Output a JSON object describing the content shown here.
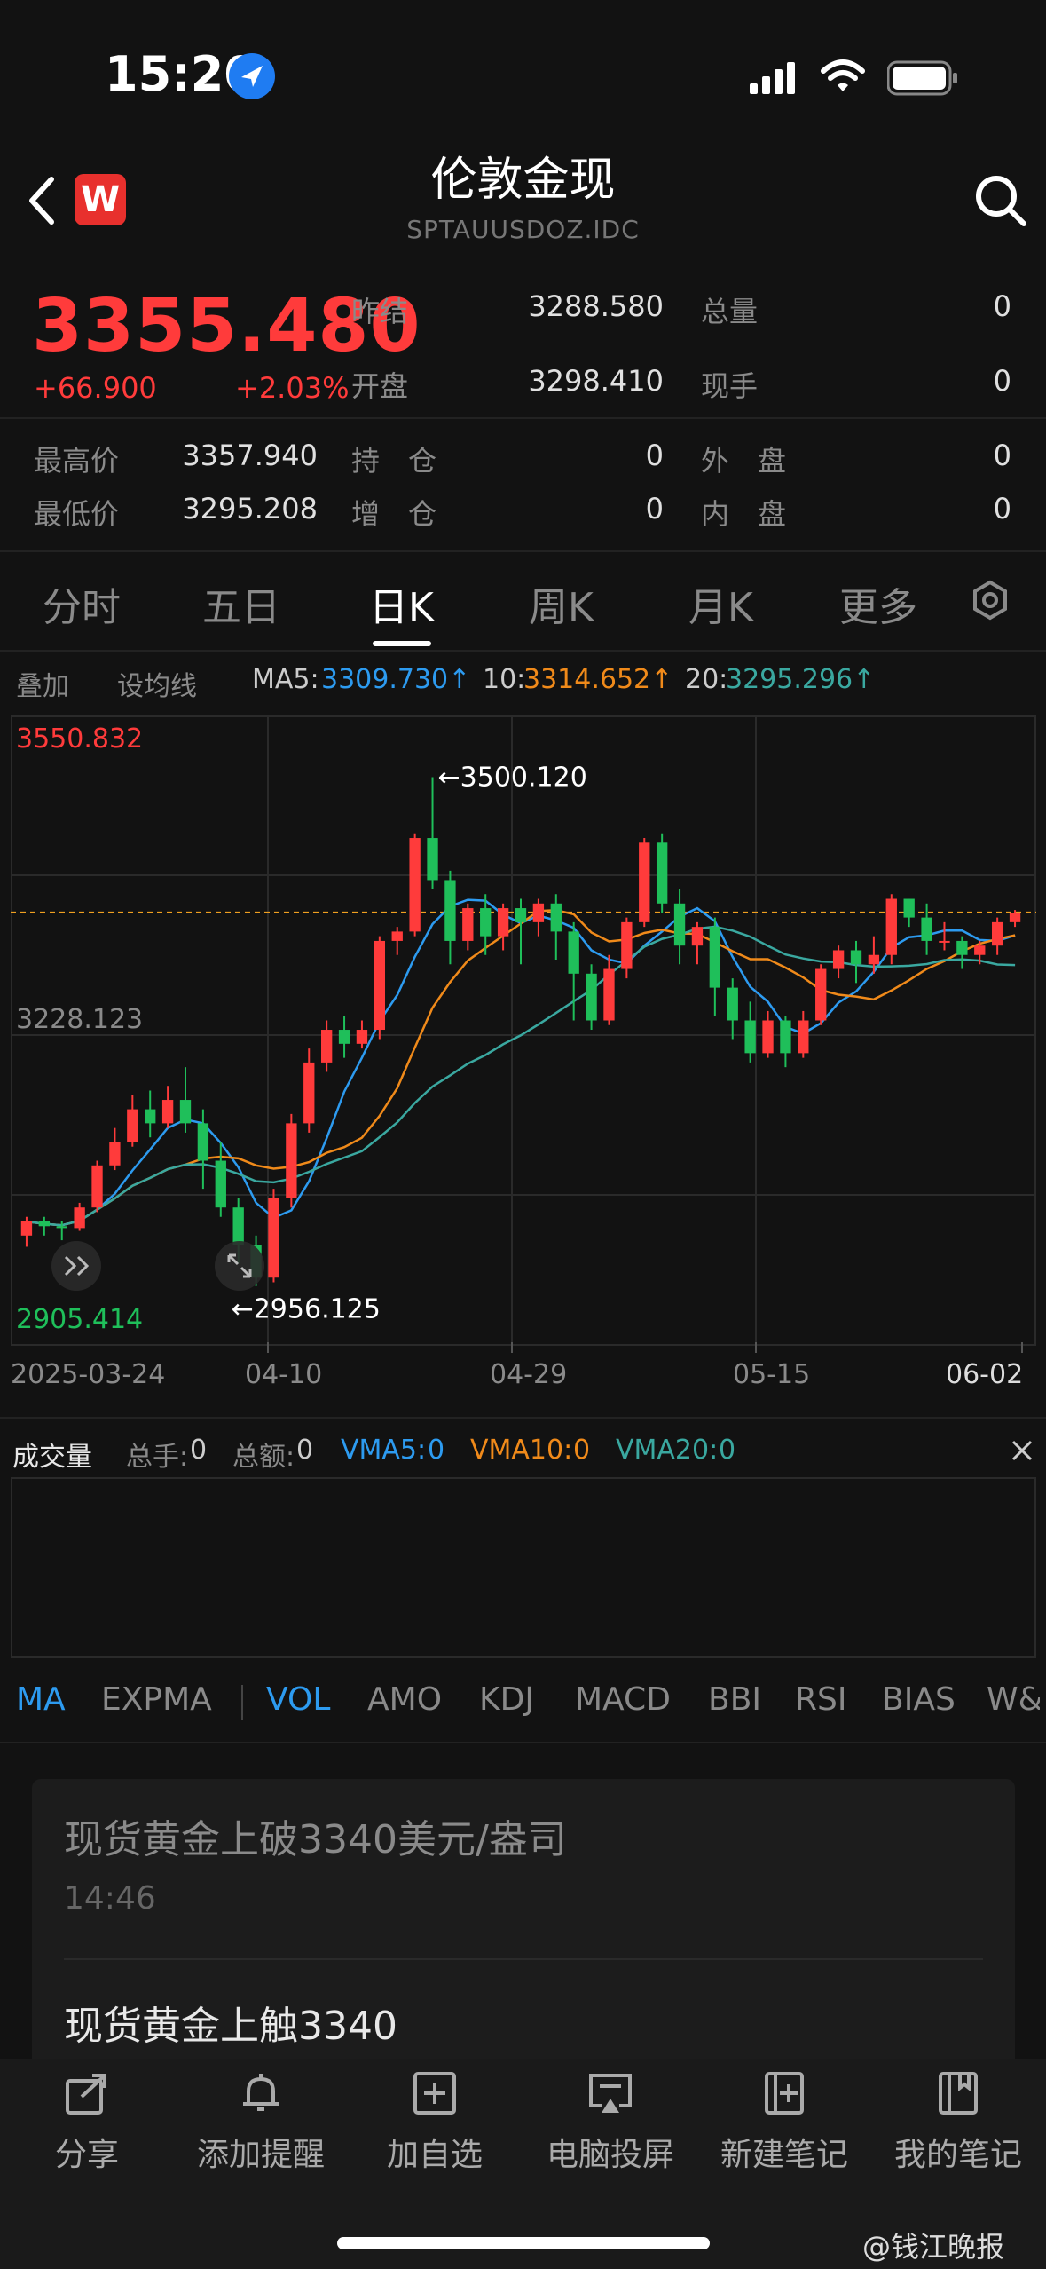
{
  "status": {
    "time": "15:20"
  },
  "header": {
    "title": "伦敦金现",
    "subtitle": "SPTAUUSDOZ.IDC",
    "logo_letter": "W"
  },
  "quote": {
    "price": "3355.480",
    "change_abs": "+66.900",
    "change_pct": "+2.03%",
    "fields": [
      {
        "label": "昨结",
        "value": "3288.580"
      },
      {
        "label": "开盘",
        "value": "3298.410"
      },
      {
        "label": "总量",
        "value": "0"
      },
      {
        "label": "现手",
        "value": "0"
      },
      {
        "label": "最高价",
        "value": "3357.940"
      },
      {
        "label": "最低价",
        "value": "3295.208"
      },
      {
        "label": "持　仓",
        "value": "0"
      },
      {
        "label": "增　仓",
        "value": "0"
      },
      {
        "label": "外　盘",
        "value": "0"
      },
      {
        "label": "内　盘",
        "value": "0"
      }
    ]
  },
  "tabs": [
    "分时",
    "五日",
    "日K",
    "周K",
    "月K",
    "更多"
  ],
  "ma_row": {
    "overlay": "叠加",
    "set_ma": "设均线",
    "ma5_label": "MA5:",
    "ma5": "3309.730↑",
    "ma10_label": "10:",
    "ma10": "3314.652↑",
    "ma20_label": "20:",
    "ma20": "3295.296↑"
  },
  "colors": {
    "up": "#ff3b3b",
    "down": "#1fbf5a",
    "ma5": "#2d9bf0",
    "ma10": "#f08a1a",
    "ma20": "#3aa8a0"
  },
  "chart_data": {
    "type": "candlestick",
    "y_top_label": "3550.832",
    "y_mid_label": "3228.123",
    "y_bottom_label": "2905.414",
    "ylim": [
      2905.414,
      3550.832
    ],
    "x_labels": [
      "2025-03-24",
      "04-10",
      "04-29",
      "05-15",
      "06-02"
    ],
    "annotations": {
      "high": "3500.120",
      "low": "2956.125"
    },
    "current_price_line": 3355.48,
    "candles": [
      [
        3010,
        3025,
        2998,
        3030
      ],
      [
        3025,
        3020,
        3010,
        3030
      ],
      [
        3020,
        3018,
        3005,
        3025
      ],
      [
        3018,
        3040,
        3015,
        3045
      ],
      [
        3040,
        3085,
        3035,
        3090
      ],
      [
        3085,
        3110,
        3080,
        3125
      ],
      [
        3110,
        3145,
        3105,
        3160
      ],
      [
        3145,
        3130,
        3115,
        3165
      ],
      [
        3130,
        3155,
        3125,
        3170
      ],
      [
        3155,
        3130,
        3120,
        3190
      ],
      [
        3130,
        3090,
        3060,
        3145
      ],
      [
        3090,
        3040,
        3030,
        3110
      ],
      [
        3040,
        3000,
        2980,
        3050
      ],
      [
        3000,
        2965,
        2956,
        3010
      ],
      [
        2965,
        3050,
        2960,
        3060
      ],
      [
        3050,
        3130,
        3040,
        3140
      ],
      [
        3130,
        3195,
        3120,
        3210
      ],
      [
        3195,
        3230,
        3185,
        3240
      ],
      [
        3230,
        3215,
        3200,
        3245
      ],
      [
        3215,
        3230,
        3210,
        3240
      ],
      [
        3230,
        3325,
        3220,
        3330
      ],
      [
        3325,
        3335,
        3310,
        3340
      ],
      [
        3335,
        3435,
        3330,
        3440
      ],
      [
        3435,
        3390,
        3380,
        3500
      ],
      [
        3390,
        3325,
        3300,
        3400
      ],
      [
        3325,
        3360,
        3315,
        3365
      ],
      [
        3360,
        3330,
        3310,
        3375
      ],
      [
        3330,
        3360,
        3315,
        3365
      ],
      [
        3360,
        3345,
        3300,
        3370
      ],
      [
        3345,
        3365,
        3330,
        3370
      ],
      [
        3365,
        3335,
        3305,
        3375
      ],
      [
        3335,
        3290,
        3240,
        3345
      ],
      [
        3290,
        3240,
        3230,
        3300
      ],
      [
        3240,
        3295,
        3235,
        3310
      ],
      [
        3295,
        3345,
        3285,
        3350
      ],
      [
        3345,
        3430,
        3340,
        3435
      ],
      [
        3430,
        3365,
        3355,
        3440
      ],
      [
        3365,
        3320,
        3300,
        3380
      ],
      [
        3320,
        3340,
        3300,
        3345
      ],
      [
        3340,
        3275,
        3245,
        3350
      ],
      [
        3275,
        3240,
        3220,
        3285
      ],
      [
        3240,
        3205,
        3195,
        3260
      ],
      [
        3205,
        3240,
        3200,
        3250
      ],
      [
        3240,
        3205,
        3190,
        3245
      ],
      [
        3205,
        3240,
        3200,
        3250
      ],
      [
        3240,
        3295,
        3235,
        3300
      ],
      [
        3295,
        3315,
        3285,
        3320
      ],
      [
        3315,
        3300,
        3280,
        3325
      ],
      [
        3300,
        3310,
        3290,
        3330
      ],
      [
        3310,
        3370,
        3300,
        3375
      ],
      [
        3370,
        3350,
        3340,
        3370
      ],
      [
        3350,
        3325,
        3310,
        3365
      ],
      [
        3325,
        3325,
        3315,
        3345
      ],
      [
        3325,
        3310,
        3295,
        3330
      ],
      [
        3310,
        3320,
        3300,
        3325
      ],
      [
        3320,
        3345,
        3310,
        3350
      ],
      [
        3345,
        3355,
        3340,
        3358
      ]
    ]
  },
  "volume": {
    "title": "成交量",
    "total_hands_label": "总手:",
    "total_hands": "0",
    "total_amount_label": "总额:",
    "total_amount": "0",
    "vma5_label": "VMA5:",
    "vma5": "0",
    "vma10_label": "VMA10:",
    "vma10": "0",
    "vma20_label": "VMA20:",
    "vma20": "0"
  },
  "indicators": [
    "MA",
    "EXPMA",
    "VOL",
    "AMO",
    "KDJ",
    "MACD",
    "BBI",
    "RSI",
    "BIAS",
    "W&"
  ],
  "news": [
    {
      "title": "现货黄金上破3340美元/盎司",
      "time": "14:46"
    },
    {
      "title": "现货黄金上触3340"
    }
  ],
  "bottom_bar": [
    "分享",
    "添加提醒",
    "加自选",
    "电脑投屏",
    "新建笔记",
    "我的笔记"
  ],
  "watermark": "@钱江晚报"
}
